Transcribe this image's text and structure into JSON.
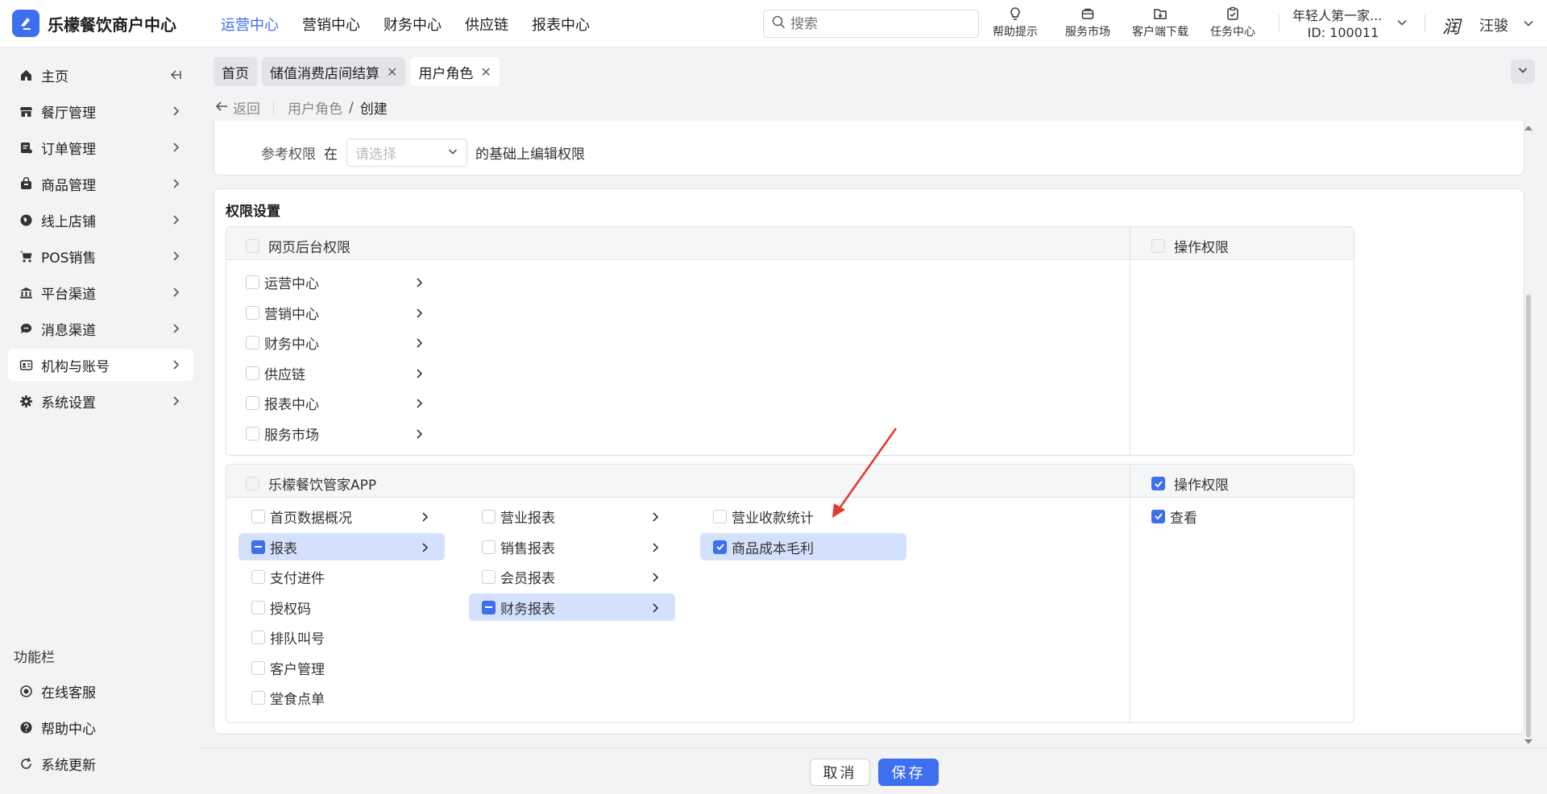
{
  "header": {
    "logo_text": "乐檬餐饮商户中心",
    "nav": [
      {
        "label": "运营中心",
        "active": true
      },
      {
        "label": "营销中心",
        "active": false
      },
      {
        "label": "财务中心",
        "active": false
      },
      {
        "label": "供应链",
        "active": false
      },
      {
        "label": "报表中心",
        "active": false
      }
    ],
    "search_placeholder": "搜索",
    "tools": [
      {
        "label": "帮助提示",
        "icon": "lightbulb-icon"
      },
      {
        "label": "服务市场",
        "icon": "shopping-bag-icon"
      },
      {
        "label": "客户端下载",
        "icon": "folder-download-icon"
      },
      {
        "label": "任务中心",
        "icon": "clipboard-check-icon"
      }
    ],
    "account_name": "年轻人第一家...",
    "account_id": "ID: 100011",
    "avatar_text": "润",
    "username": "汪骏"
  },
  "sidebar": {
    "items": [
      {
        "label": "主页",
        "icon": "home-icon"
      },
      {
        "label": "餐厅管理",
        "icon": "store-icon"
      },
      {
        "label": "订单管理",
        "icon": "order-icon"
      },
      {
        "label": "商品管理",
        "icon": "bag-icon"
      },
      {
        "label": "线上店铺",
        "icon": "globe-icon"
      },
      {
        "label": "POS销售",
        "icon": "cart-icon"
      },
      {
        "label": "平台渠道",
        "icon": "building-icon"
      },
      {
        "label": "消息渠道",
        "icon": "message-icon"
      },
      {
        "label": "机构与账号",
        "icon": "id-card-icon"
      },
      {
        "label": "系统设置",
        "icon": "gear-icon"
      }
    ],
    "section_title": "功能栏",
    "bottom_items": [
      {
        "label": "在线客服",
        "icon": "support-icon"
      },
      {
        "label": "帮助中心",
        "icon": "help-icon"
      },
      {
        "label": "系统更新",
        "icon": "refresh-icon"
      }
    ]
  },
  "tabs": [
    {
      "label": "首页",
      "closable": false
    },
    {
      "label": "储值消费店间结算",
      "closable": true
    },
    {
      "label": "用户角色",
      "closable": true
    }
  ],
  "breadcrumb": {
    "back": "返回",
    "parent": "用户角色",
    "separator": "/",
    "current": "创建"
  },
  "reference": {
    "label": "参考权限",
    "in": "在",
    "select_placeholder": "请选择",
    "after": "的基础上编辑权限"
  },
  "permissions": {
    "title": "权限设置",
    "web": {
      "header": "网页后台权限",
      "ops_header": "操作权限",
      "items": [
        "运营中心",
        "营销中心",
        "财务中心",
        "供应链",
        "报表中心",
        "服务市场"
      ]
    },
    "app": {
      "header": "乐檬餐饮管家APP",
      "ops_header": "操作权限",
      "col1": [
        "首页数据概况",
        "报表",
        "支付进件",
        "授权码",
        "排队叫号",
        "客户管理",
        "堂食点单"
      ],
      "col2": [
        "营业报表",
        "销售报表",
        "会员报表",
        "财务报表"
      ],
      "col3": [
        "营业收款统计",
        "商品成本毛利"
      ],
      "ops": [
        "查看"
      ]
    }
  },
  "footer": {
    "cancel": "取消",
    "save": "保存"
  },
  "colors": {
    "accent": "#3d6fef",
    "highlight": "#d4e1fc",
    "annotation_arrow": "#e5392d"
  }
}
